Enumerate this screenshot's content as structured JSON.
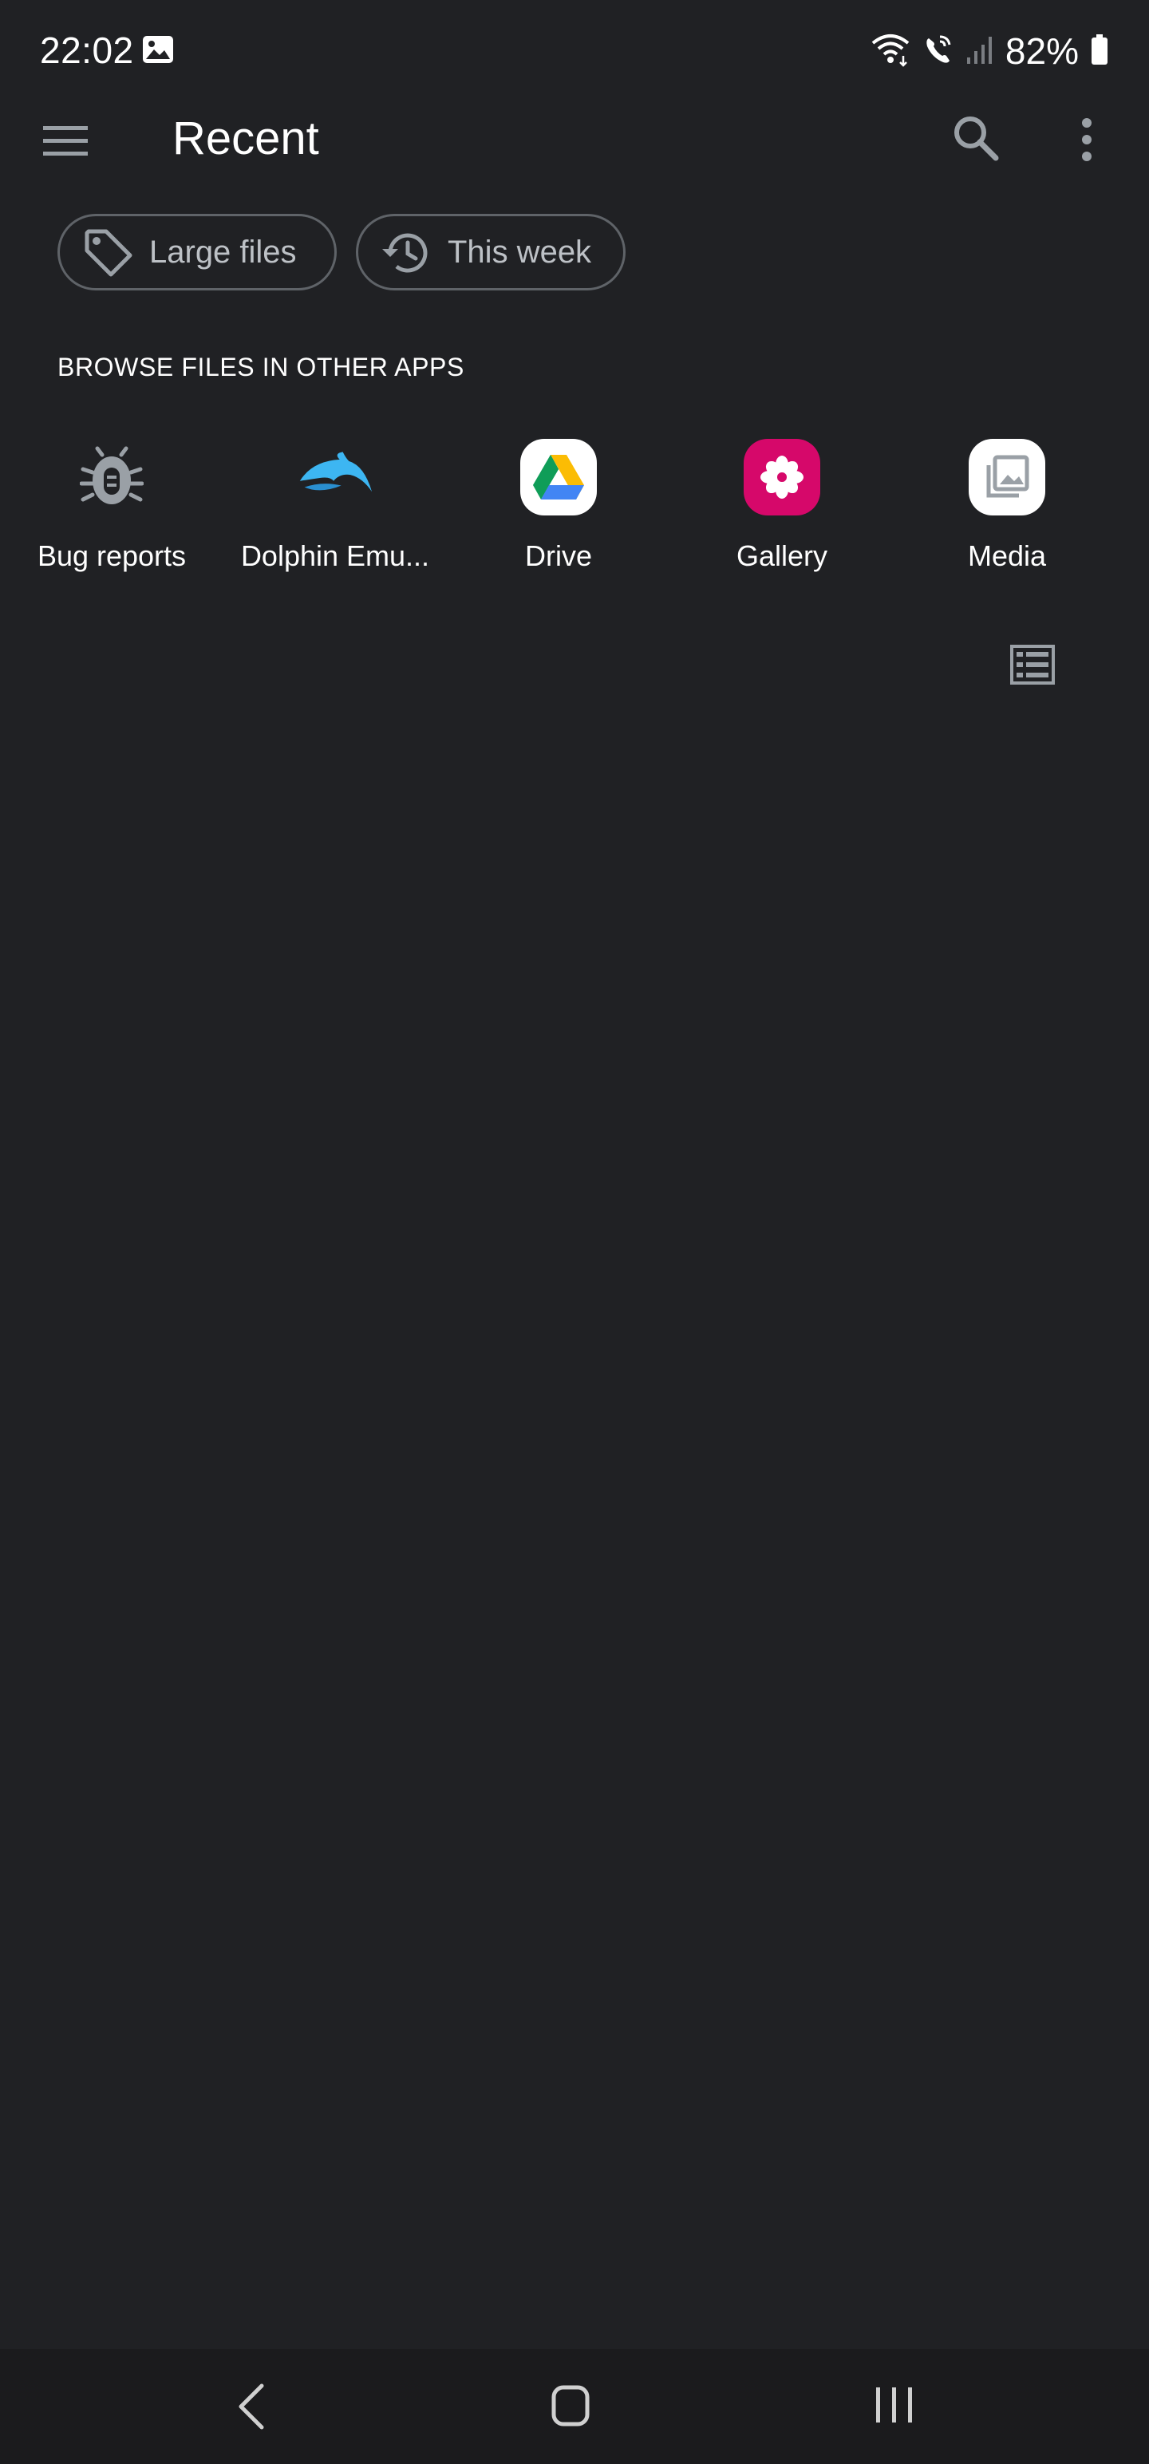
{
  "status_bar": {
    "time": "22:02",
    "battery": "82%",
    "icons": [
      "gallery-notification-icon",
      "wifi-icon",
      "wifi-calling-icon",
      "signal-icon",
      "battery-icon"
    ]
  },
  "app_bar": {
    "title": "Recent",
    "menu_icon": "hamburger-menu-icon",
    "search_icon": "search-icon",
    "more_icon": "more-vert-icon"
  },
  "chips": [
    {
      "label": "Large files",
      "icon": "tag-icon"
    },
    {
      "label": "This week",
      "icon": "history-icon"
    }
  ],
  "section": {
    "label": "BROWSE FILES IN OTHER APPS"
  },
  "apps": [
    {
      "label": "Bug reports",
      "icon": "bug-icon"
    },
    {
      "label": "Dolphin Emu...",
      "icon": "dolphin-icon"
    },
    {
      "label": "Drive",
      "icon": "google-drive-icon"
    },
    {
      "label": "Gallery",
      "icon": "gallery-flower-icon"
    },
    {
      "label": "Media",
      "icon": "media-icon"
    }
  ],
  "view_toggle_icon": "list-view-icon",
  "nav_bar": {
    "icons": [
      "back-icon",
      "home-icon",
      "recents-icon"
    ]
  },
  "colors": {
    "background": "#202124",
    "nav_background": "#1b1b1d",
    "chip_border": "#5f6368",
    "icon_gray": "#9aa0a6",
    "dolphin_blue": "#3db6f2",
    "gallery_pink": "#d6086a"
  }
}
